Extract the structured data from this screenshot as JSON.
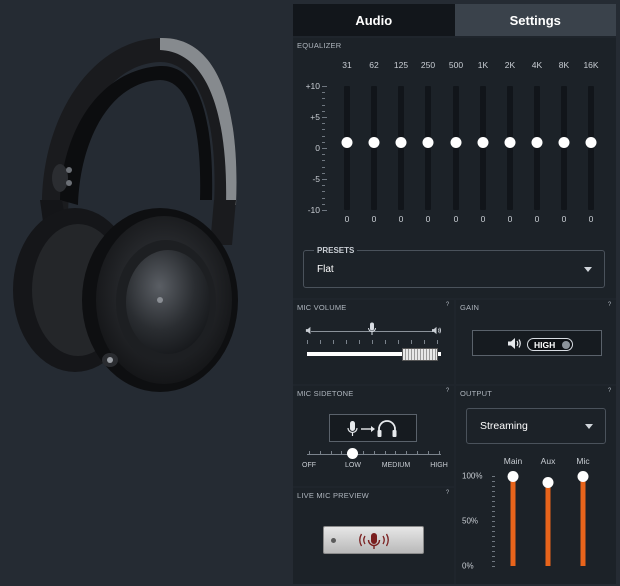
{
  "tabs": [
    {
      "label": "Audio"
    },
    {
      "label": "Settings"
    }
  ],
  "equalizer": {
    "title": "EQUALIZER",
    "frequencies": [
      "31",
      "62",
      "125",
      "250",
      "500",
      "1K",
      "2K",
      "4K",
      "8K",
      "16K"
    ],
    "db_labels": [
      "+10",
      "+5",
      "0",
      "-5",
      "-10"
    ],
    "values": [
      "0",
      "0",
      "0",
      "0",
      "0",
      "0",
      "0",
      "0",
      "0",
      "0"
    ],
    "presets": {
      "label": "PRESETS",
      "value": "Flat"
    }
  },
  "mic_volume": {
    "title": "MIC VOLUME",
    "help": "?",
    "level": 0.9
  },
  "gain": {
    "title": "GAIN",
    "help": "?",
    "value": "HIGH"
  },
  "mic_sidetone": {
    "title": "MIC SIDETONE",
    "help": "?",
    "levels": [
      "OFF",
      "LOW",
      "MEDIUM",
      "HIGH"
    ],
    "selected": "LOW"
  },
  "live_mic_preview": {
    "title": "LIVE MIC PREVIEW",
    "help": "?"
  },
  "output": {
    "title": "OUTPUT",
    "help": "?",
    "selected": "Streaming",
    "scale": [
      "100%",
      "50%",
      "0%"
    ],
    "channels": [
      {
        "label": "Main",
        "level": 1.0
      },
      {
        "label": "Aux",
        "level": 0.93
      },
      {
        "label": "Mic",
        "level": 1.0
      }
    ]
  },
  "colors": {
    "accent": "#e8641b",
    "panel": "#1c2228",
    "tab_active": "#12161b"
  }
}
